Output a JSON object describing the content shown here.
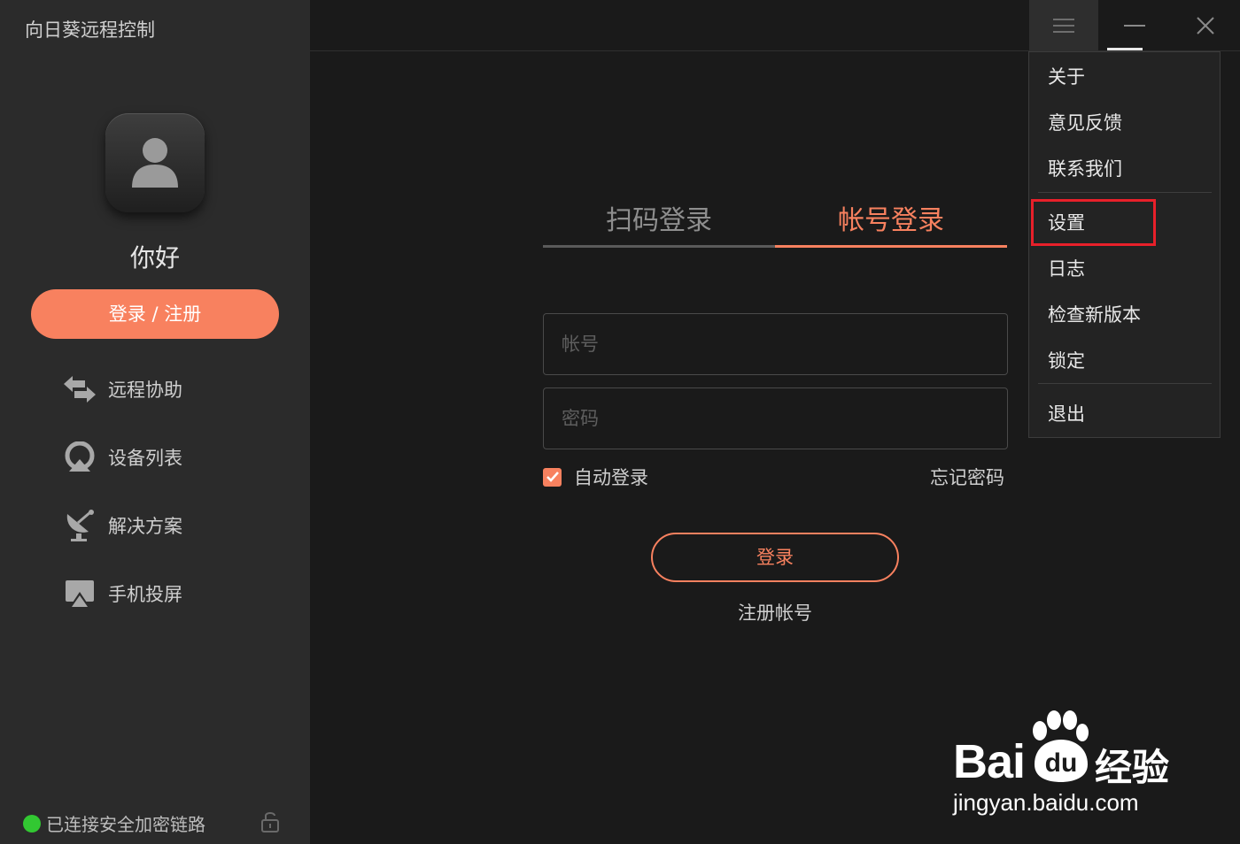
{
  "app": {
    "title": "向日葵远程控制"
  },
  "sidebar": {
    "greeting": "你好",
    "login_register_label": "登录 / 注册",
    "nav": [
      {
        "label": "远程协助",
        "icon": "remote-assist-icon"
      },
      {
        "label": "设备列表",
        "icon": "device-list-icon"
      },
      {
        "label": "解决方案",
        "icon": "solutions-icon"
      },
      {
        "label": "手机投屏",
        "icon": "phone-cast-icon"
      }
    ],
    "status_text": "已连接安全加密链路"
  },
  "login": {
    "tabs": [
      {
        "label": "扫码登录"
      },
      {
        "label": "帐号登录"
      }
    ],
    "active_tab": "帐号登录",
    "account_placeholder": "帐号",
    "password_placeholder": "密码",
    "auto_login_label": "自动登录",
    "auto_login_checked": true,
    "forgot_label": "忘记密码",
    "submit_label": "登录",
    "register_label": "注册帐号"
  },
  "menu": {
    "items": [
      "关于",
      "意见反馈",
      "联系我们",
      "设置",
      "日志",
      "检查新版本",
      "锁定",
      "退出"
    ],
    "highlighted": "设置"
  },
  "watermark": {
    "brand": "Bai",
    "brand_cn": "经验",
    "url": "jingyan.baidu.com"
  },
  "colors": {
    "accent": "#f8815f",
    "background": "#1a1a1a",
    "sidebar": "#2b2b2b",
    "status": "#32c832",
    "highlight": "#e8202a"
  }
}
